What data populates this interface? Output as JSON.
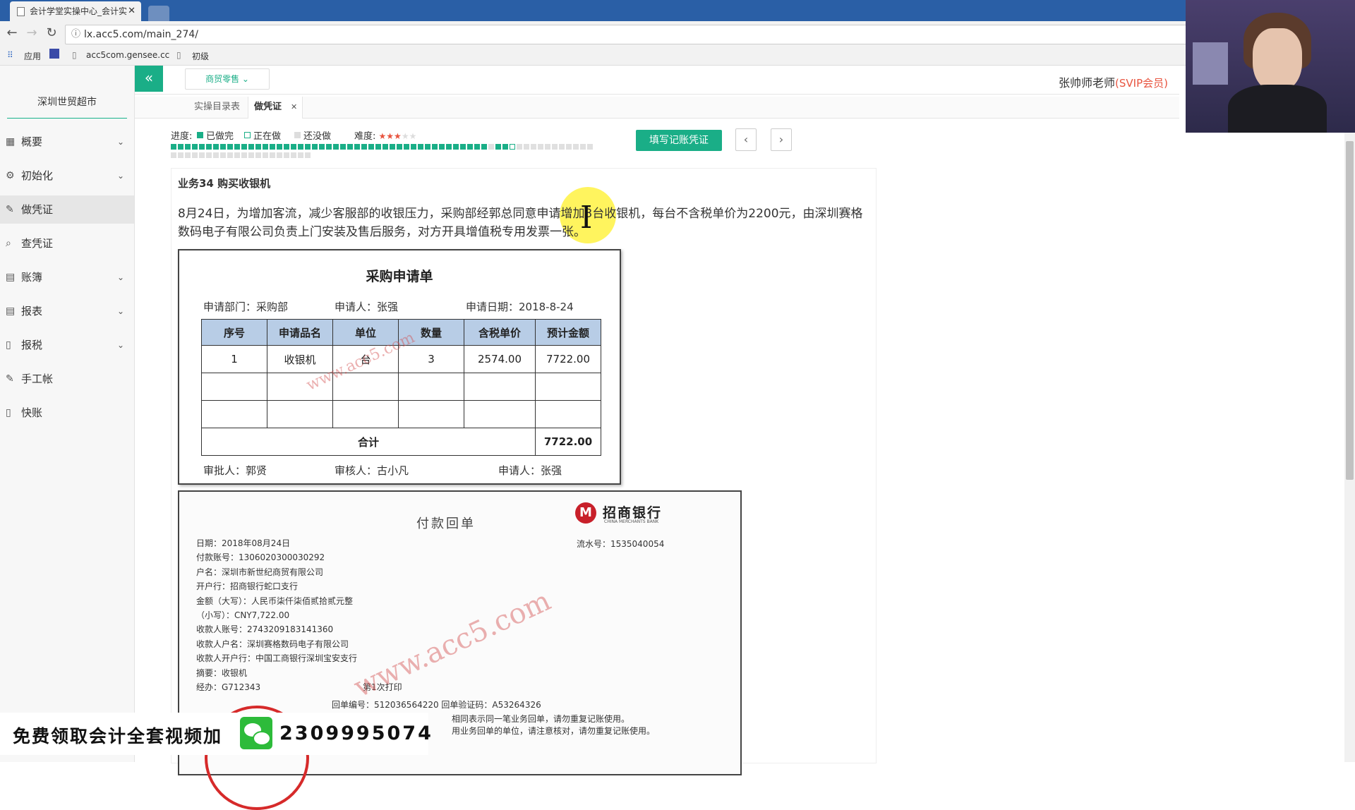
{
  "browser": {
    "tab_title": "会计学堂实操中心_会计实",
    "tab_close": "✕",
    "url": "lx.acc5.com/main_274/",
    "bookmarks": [
      "应用",
      "acc5com.gensee.cc",
      "初级"
    ]
  },
  "sidebar": {
    "company": "深圳世贸超市",
    "items": [
      {
        "label": "概要",
        "icon": "grid-icon",
        "chevron": "⌄"
      },
      {
        "label": "初始化",
        "icon": "gear-icon",
        "chevron": "⌄"
      },
      {
        "label": "做凭证",
        "icon": "pen-icon",
        "chevron": ""
      },
      {
        "label": "查凭证",
        "icon": "search-icon",
        "chevron": ""
      },
      {
        "label": "账簿",
        "icon": "book-icon",
        "chevron": "⌄"
      },
      {
        "label": "报表",
        "icon": "report-icon",
        "chevron": "⌄"
      },
      {
        "label": "报税",
        "icon": "file-icon",
        "chevron": "⌄"
      },
      {
        "label": "手工帐",
        "icon": "pen-icon",
        "chevron": ""
      },
      {
        "label": "快账",
        "icon": "file-icon",
        "chevron": ""
      }
    ],
    "active_index": 2
  },
  "header": {
    "collapse": "«",
    "industry": "商贸零售 ⌄",
    "user_name": "张帅师老师",
    "user_vip": "(SVIP会员)"
  },
  "tabs": {
    "catalog": "实操目录表",
    "current": "做凭证",
    "current_close": "✕"
  },
  "progress": {
    "label": "进度:",
    "legend_done": "已做完",
    "legend_doing": "正在做",
    "legend_todo": "还没做",
    "difficulty_label": "难度:",
    "difficulty_stars": "★★★",
    "difficulty_off": "★★",
    "total": 80,
    "done": 45,
    "current": 48,
    "colors": {
      "done": "#1aae87",
      "doing": "#ffffff",
      "todo": "#e0e0e0",
      "stars": "#e8543f"
    }
  },
  "actions": {
    "fill_voucher": "填写记账凭证",
    "prev": "‹",
    "next": "›"
  },
  "business": {
    "title": "业务34 购买收银机",
    "description": "8月24日，为增加客流，减少客服部的收银压力，采购部经郭总同意申请增加3台收银机，每台不含税单价为2200元，由深圳赛格数码电子有限公司负责上门安装及售后服务，对方开具增值税专用发票一张。"
  },
  "purchase_form": {
    "title": "采购申请单",
    "dept": "申请部门：采购部",
    "applicant": "申请人：张强",
    "date": "申请日期：2018-8-24",
    "headers": [
      "序号",
      "申请品名",
      "单位",
      "数量",
      "含税单价",
      "预计金额"
    ],
    "rows": [
      [
        "1",
        "收银机",
        "台",
        "3",
        "2574.00",
        "7722.00"
      ],
      [
        "",
        "",
        "",
        "",
        "",
        ""
      ],
      [
        "",
        "",
        "",
        "",
        "",
        ""
      ]
    ],
    "total_label": "合计",
    "total_value": "7722.00",
    "approver": "审批人：郭贤",
    "reviewer": "审核人：古小凡",
    "requester": "申请人：张强",
    "watermark": "www.acc5.com"
  },
  "receipt": {
    "title": "付款回单",
    "bank_name": "招商银行",
    "bank_en": "CHINA MERCHANTS BANK",
    "bank_logo": "M",
    "serial": "流水号：1535040054",
    "lines": [
      "日期：2018年08月24日",
      "付款账号：1306020300030292",
      "户名：深圳市新世纪商贸有限公司",
      "开户行：招商银行蛇口支行",
      "金额（大写）：人民币柒仟柒佰贰拾贰元整",
      "（小写）：CNY7,722.00",
      "收款人账号：2743209183141360",
      "收款人户名：深圳赛格数码电子有限公司",
      "收款人开户行：中国工商银行深圳宝安支行",
      "摘要：收银机",
      "经办：G712343"
    ],
    "print_no": "第1次打印",
    "bottom": "回单编号：512036564220 回单验证码：A53264326",
    "note1": "相同表示同一笔业务回单，请勿重复记账使用。",
    "note2": "用业务回单的单位，请注意核对，请勿重复记账使用。",
    "watermark": "www.acc5.com"
  },
  "banner": {
    "text": "免费领取会计全套视频加",
    "phone": "2309995074"
  }
}
